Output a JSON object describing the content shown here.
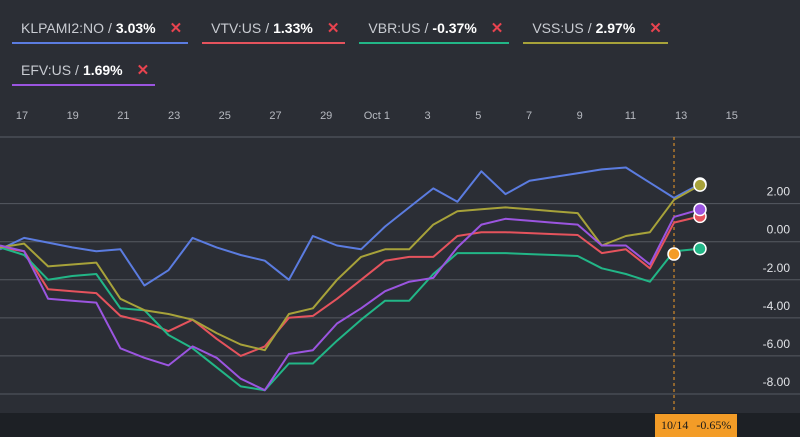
{
  "legend": [
    {
      "ticker": "KLPAMI2:NO",
      "pct": "3.03%",
      "color": "#5b7ce0"
    },
    {
      "ticker": "VTV:US",
      "pct": "1.33%",
      "color": "#e5535d"
    },
    {
      "ticker": "VBR:US",
      "pct": "-0.37%",
      "color": "#22b687"
    },
    {
      "ticker": "VSS:US",
      "pct": "2.97%",
      "color": "#a7a23a"
    },
    {
      "ticker": "EFV:US",
      "pct": "1.69%",
      "color": "#9b55e0"
    }
  ],
  "separator": "/",
  "close_glyph": "✕",
  "crosshair": {
    "date": "10/14",
    "value": "-0.65%",
    "color": "#f39c27"
  },
  "chart_data": {
    "type": "line",
    "x_ticks": [
      "17",
      "19",
      "21",
      "23",
      "25",
      "27",
      "29",
      "Oct 1",
      "3",
      "5",
      "7",
      "9",
      "11",
      "13",
      "15"
    ],
    "y_ticks": [
      {
        "value": 2,
        "label": "2.00"
      },
      {
        "value": 0,
        "label": "0.00"
      },
      {
        "value": -2,
        "label": "-2.00"
      },
      {
        "value": -4,
        "label": "-4.00"
      },
      {
        "value": -6,
        "label": "-6.00"
      },
      {
        "value": -8,
        "label": "-8.00"
      }
    ],
    "ylim": [
      -9,
      5.5
    ],
    "xlim": [
      0,
      29
    ],
    "grid": true,
    "crosshair_index": 28,
    "series": [
      {
        "name": "KLPAMI2:NO",
        "color": "#5b7ce0",
        "x": [
          0,
          1,
          2,
          3,
          4,
          5,
          6,
          7,
          8,
          9,
          10,
          11,
          12,
          13,
          14,
          15,
          16,
          17,
          18,
          19,
          20,
          21,
          22,
          23,
          24,
          25,
          26,
          27,
          28
        ],
        "values": [
          -0.4,
          0.2,
          -0.05,
          -0.3,
          -0.5,
          -0.4,
          -2.3,
          -1.5,
          0.2,
          -0.3,
          -0.7,
          -1.0,
          -2.0,
          0.3,
          -0.2,
          -0.4,
          0.8,
          1.8,
          2.8,
          2.1,
          3.7,
          2.5,
          3.2,
          3.4,
          3.6,
          3.8,
          3.9,
          3.1,
          2.3
        ],
        "end_label": "3.03%"
      },
      {
        "name": "VTV:US",
        "color": "#e5535d",
        "x": [
          0,
          1,
          2,
          3,
          4,
          5,
          6,
          7,
          8,
          9,
          10,
          11,
          12,
          13,
          14,
          15,
          16,
          17,
          18,
          19,
          20,
          21,
          22,
          23,
          24,
          25,
          26,
          27,
          28
        ],
        "values": [
          -0.3,
          -0.5,
          -2.5,
          -2.6,
          -2.7,
          -3.9,
          -4.2,
          -4.7,
          -4.1,
          -5.1,
          -6.0,
          -5.5,
          -4.0,
          -3.9,
          -3.0,
          -2.0,
          -1.0,
          -0.8,
          -0.8,
          0.3,
          0.5,
          0.5,
          0.45,
          0.4,
          0.35,
          -0.6,
          -0.4,
          -1.4,
          1.0
        ],
        "end_label": "1.33%"
      },
      {
        "name": "VBR:US",
        "color": "#22b687",
        "x": [
          0,
          1,
          2,
          3,
          4,
          5,
          6,
          7,
          8,
          9,
          10,
          11,
          12,
          13,
          14,
          15,
          16,
          17,
          18,
          19,
          20,
          21,
          22,
          23,
          24,
          25,
          26,
          27,
          28
        ],
        "values": [
          -0.3,
          -0.7,
          -2.0,
          -1.8,
          -1.7,
          -3.5,
          -3.6,
          -4.9,
          -5.6,
          -6.6,
          -7.6,
          -7.8,
          -6.4,
          -6.4,
          -5.2,
          -4.1,
          -3.1,
          -3.1,
          -1.7,
          -0.6,
          -0.6,
          -0.6,
          -0.65,
          -0.7,
          -0.75,
          -1.4,
          -1.7,
          -2.1,
          -0.5
        ],
        "end_label": "-0.37%"
      },
      {
        "name": "VSS:US",
        "color": "#a7a23a",
        "x": [
          0,
          1,
          2,
          3,
          4,
          5,
          6,
          7,
          8,
          9,
          10,
          11,
          12,
          13,
          14,
          15,
          16,
          17,
          18,
          19,
          20,
          21,
          22,
          23,
          24,
          25,
          26,
          27,
          28
        ],
        "values": [
          -0.3,
          -0.1,
          -1.3,
          -1.2,
          -1.1,
          -3.0,
          -3.6,
          -3.8,
          -4.1,
          -4.8,
          -5.4,
          -5.7,
          -3.8,
          -3.5,
          -2.0,
          -0.8,
          -0.4,
          -0.4,
          0.9,
          1.6,
          1.7,
          1.8,
          1.7,
          1.6,
          1.5,
          -0.2,
          0.3,
          0.5,
          2.2
        ],
        "end_label": "2.97%"
      },
      {
        "name": "EFV:US",
        "color": "#9b55e0",
        "x": [
          0,
          1,
          2,
          3,
          4,
          5,
          6,
          7,
          8,
          9,
          10,
          11,
          12,
          13,
          14,
          15,
          16,
          17,
          18,
          19,
          20,
          21,
          22,
          23,
          24,
          25,
          26,
          27,
          28
        ],
        "values": [
          -0.2,
          -0.5,
          -3.0,
          -3.1,
          -3.2,
          -5.6,
          -6.1,
          -6.5,
          -5.5,
          -6.1,
          -7.2,
          -7.8,
          -5.9,
          -5.7,
          -4.3,
          -3.5,
          -2.6,
          -2.1,
          -1.9,
          -0.3,
          0.9,
          1.2,
          1.1,
          1.0,
          0.9,
          -0.2,
          -0.2,
          -1.2,
          1.3
        ],
        "end_label": "1.69%"
      }
    ]
  }
}
